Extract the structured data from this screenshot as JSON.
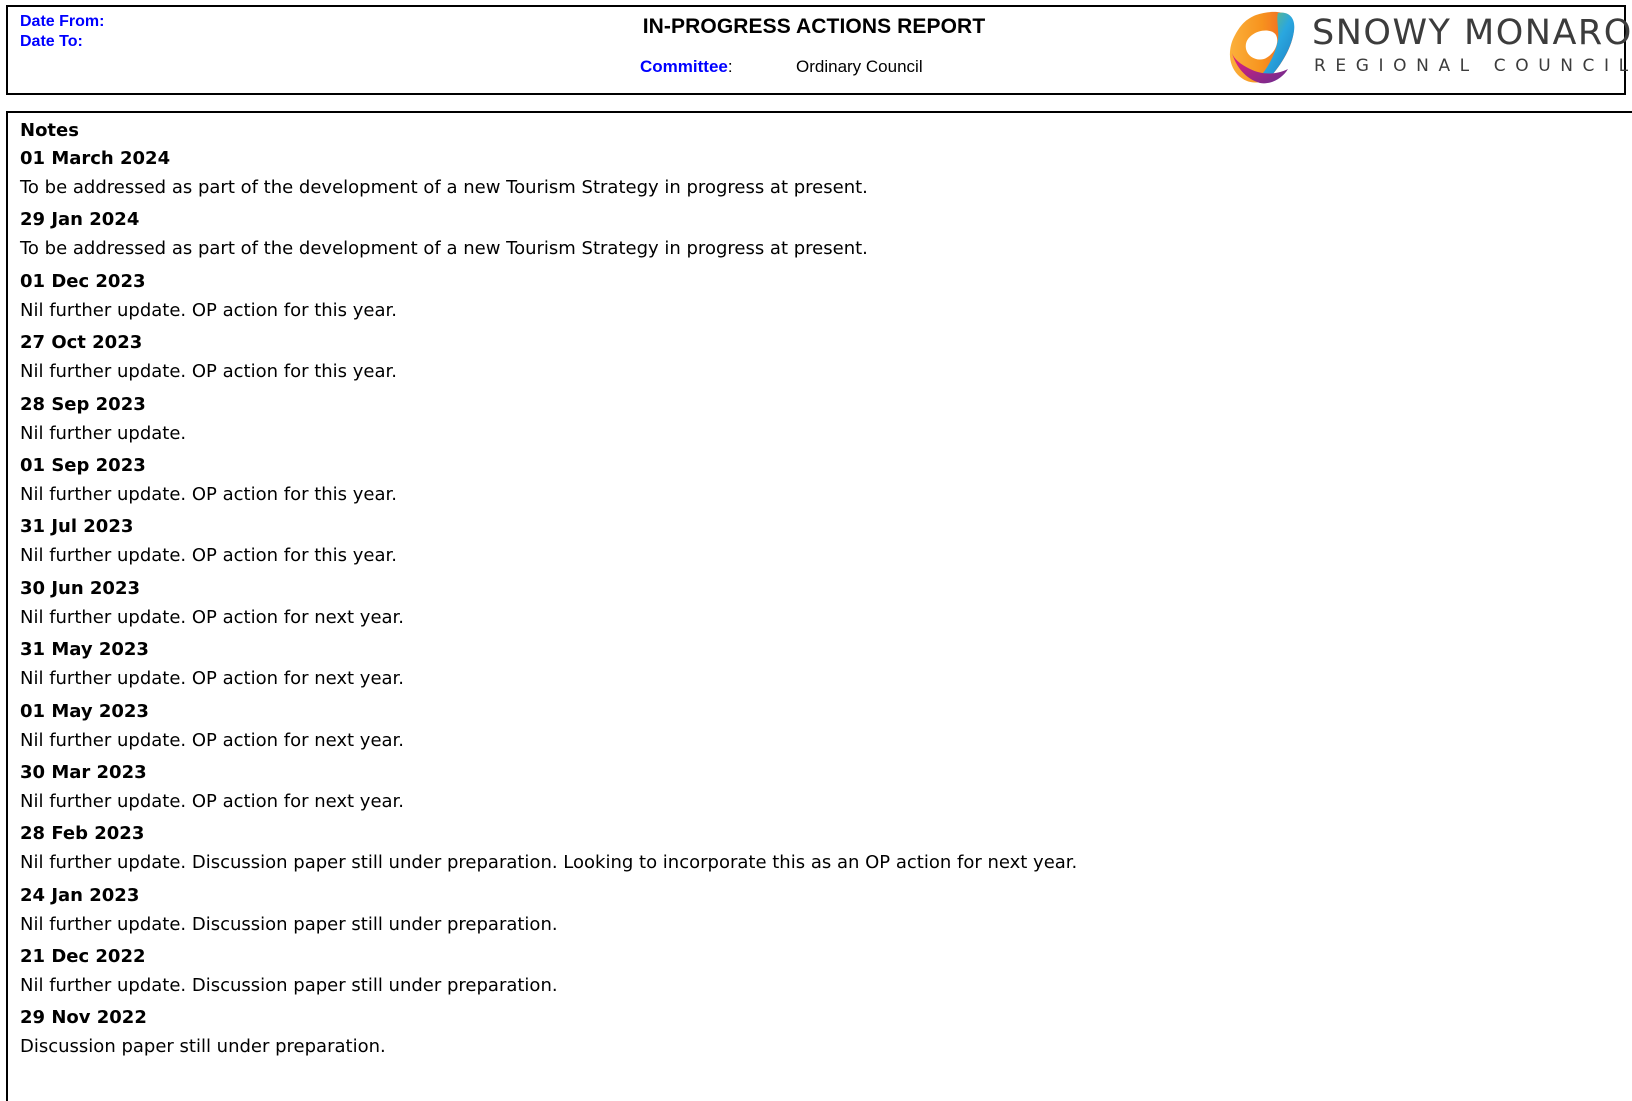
{
  "header": {
    "date_from_label": "Date From:",
    "date_to_label": "Date To:",
    "title": "IN-PROGRESS ACTIONS REPORT",
    "committee_label": "Committee",
    "committee_colon": ":",
    "committee_value": "Ordinary Council"
  },
  "logo": {
    "name": "SNOWY MONARO",
    "subtitle": "REGIONAL COUNCIL",
    "colors": [
      "#f7931e",
      "#e8336d",
      "#8e3b9c",
      "#2aa7df",
      "#8cc63f"
    ]
  },
  "notes": {
    "heading": "Notes",
    "entries": [
      {
        "date": "01 March 2024",
        "text": "To be addressed as part of the development of a new Tourism Strategy in progress at present."
      },
      {
        "date": "29 Jan 2024",
        "text": "To be addressed as part of the development of a new Tourism Strategy in progress at present."
      },
      {
        "date": "01 Dec 2023",
        "text": "Nil further update. OP action for this year."
      },
      {
        "date": "27 Oct 2023",
        "text": "Nil further update. OP action for this year."
      },
      {
        "date": "28 Sep 2023",
        "text": "Nil further update."
      },
      {
        "date": "01 Sep 2023",
        "text": "Nil further update. OP action for this year."
      },
      {
        "date": "31 Jul 2023",
        "text": "Nil further update. OP action for this year."
      },
      {
        "date": "30 Jun 2023",
        "text": "Nil further update. OP action for next year."
      },
      {
        "date": "31 May 2023",
        "text": "Nil further update. OP action for next year."
      },
      {
        "date": "01 May 2023",
        "text": "Nil further update. OP action for next year."
      },
      {
        "date": "30 Mar 2023",
        "text": "Nil further update. OP action for next year."
      },
      {
        "date": "28 Feb 2023",
        "text": "Nil further update. Discussion paper still under preparation. Looking to incorporate this as an OP action for next year."
      },
      {
        "date": "24 Jan 2023",
        "text": "Nil further update. Discussion paper still under preparation."
      },
      {
        "date": "21 Dec 2022",
        "text": "Nil further update. Discussion paper still under preparation."
      },
      {
        "date": "29 Nov 2022",
        "text": "Discussion paper still under preparation."
      }
    ]
  }
}
